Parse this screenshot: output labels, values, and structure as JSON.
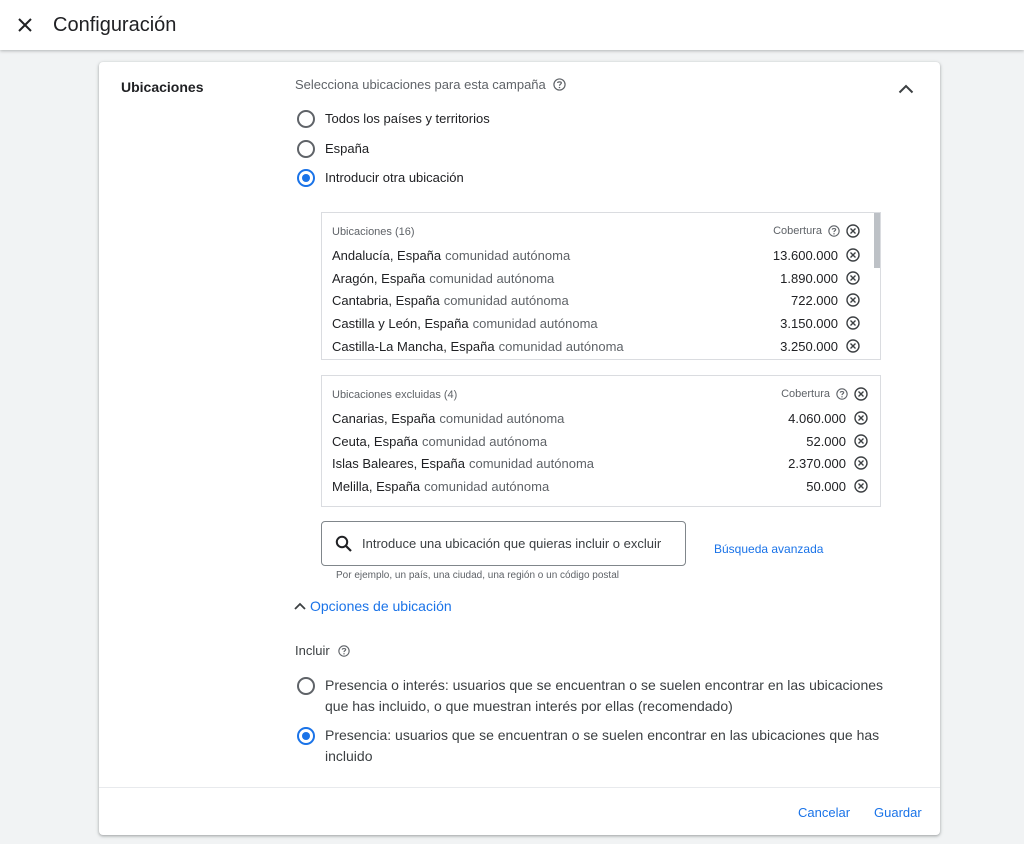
{
  "header": {
    "title": "Configuración",
    "close_icon": "close-icon"
  },
  "section": {
    "title": "Ubicaciones",
    "prompt": "Selecciona ubicaciones para esta campaña",
    "options": [
      {
        "label": "Todos los países y territorios",
        "selected": false
      },
      {
        "label": "España",
        "selected": false
      },
      {
        "label": "Introducir otra ubicación",
        "selected": true
      }
    ]
  },
  "included": {
    "header": "Ubicaciones (16)",
    "coverage_label": "Cobertura",
    "rows": [
      {
        "name": "Andalucía, España",
        "type": "comunidad autónoma",
        "coverage": "13.600.000"
      },
      {
        "name": "Aragón, España",
        "type": "comunidad autónoma",
        "coverage": "1.890.000"
      },
      {
        "name": "Cantabria, España",
        "type": "comunidad autónoma",
        "coverage": "722.000"
      },
      {
        "name": "Castilla y León, España",
        "type": "comunidad autónoma",
        "coverage": "3.150.000"
      },
      {
        "name": "Castilla-La Mancha, España",
        "type": "comunidad autónoma",
        "coverage": "3.250.000"
      }
    ]
  },
  "excluded": {
    "header": "Ubicaciones excluidas (4)",
    "coverage_label": "Cobertura",
    "rows": [
      {
        "name": "Canarias, España",
        "type": "comunidad autónoma",
        "coverage": "4.060.000"
      },
      {
        "name": "Ceuta, España",
        "type": "comunidad autónoma",
        "coverage": "52.000"
      },
      {
        "name": "Islas Baleares, España",
        "type": "comunidad autónoma",
        "coverage": "2.370.000"
      },
      {
        "name": "Melilla, España",
        "type": "comunidad autónoma",
        "coverage": "50.000"
      }
    ]
  },
  "search": {
    "placeholder": "Introduce una ubicación que quieras incluir o excluir",
    "advanced_link": "Búsqueda avanzada",
    "hint": "Por ejemplo, un país, una ciudad, una región o un código postal"
  },
  "location_options": {
    "toggle_label": "Opciones de ubicación",
    "include_label": "Incluir",
    "choices": [
      {
        "label": "Presencia o interés: usuarios que se encuentran o se suelen encontrar en las ubicaciones que has incluido, o que muestran interés por ellas (recomendado)",
        "selected": false
      },
      {
        "label": "Presencia: usuarios que se encuentran o se suelen encontrar en las ubicaciones que has incluido",
        "selected": true
      }
    ]
  },
  "footer": {
    "cancel": "Cancelar",
    "save": "Guardar"
  },
  "colors": {
    "accent": "#1a73e8",
    "text": "#202124",
    "secondary": "#5f6368",
    "background": "#f1f3f4"
  }
}
